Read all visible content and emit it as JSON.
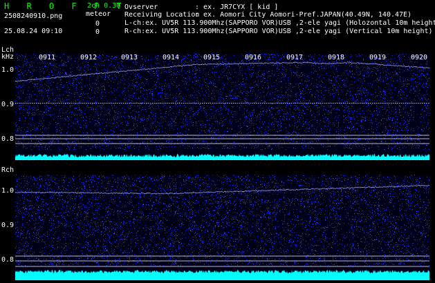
{
  "header": {
    "brand": "H R O F F T",
    "mode": "2ch 0.30",
    "filename": "2508240910.png",
    "meteor_label": "meteor",
    "datetime": "25.08.24 09:10",
    "meteor_count_l": "0",
    "meteor_count_r": "0",
    "observer_label": "Ovserver",
    "observer_value": ": ex. JR7CYX [ kid ]",
    "location_label": "Receiving Location",
    "location_value": ": ex. Aomori City Aomori-Pref.JAPAN(40.49N, 140.47E)",
    "lch_desc": "L-ch:ex. UV5R 113.900Mhz(SAPPORO VOR)USB ,2-ele yagi (Holozontal 10m height)",
    "rch_desc": "R-ch:ex. UV5R 113.900Mhz(SAPPORO VOR)USB ,2-ele yagi (Vertical 10m height)"
  },
  "time_ticks": [
    "0911",
    "0912",
    "0913",
    "0914",
    "0915",
    "0916",
    "0917",
    "0918",
    "0919",
    "0920"
  ],
  "lch": {
    "label": "Lch",
    "unit": "kHz",
    "y_labels": [
      "1.0",
      "0.9",
      "0.8"
    ]
  },
  "rch": {
    "label": "Rch",
    "y_labels": [
      "1.0",
      "0.9",
      "0.8"
    ]
  },
  "colors": {
    "background": "#000000",
    "noise": "#1a2fe0",
    "trace": "#aab4ff",
    "amplitude": "#00ffff",
    "header_green": "#00ff00",
    "text": "#ffffff"
  }
}
